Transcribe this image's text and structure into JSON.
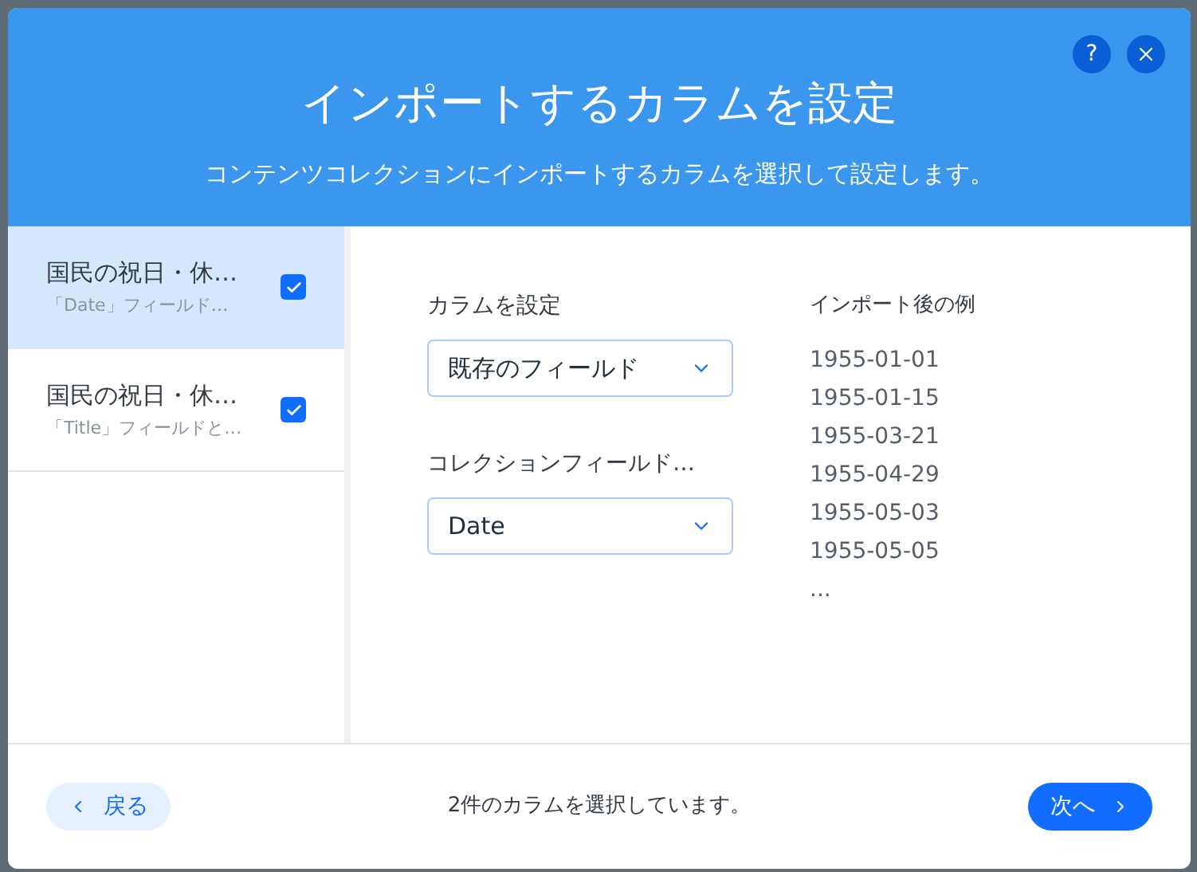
{
  "dialog": {
    "help": "?",
    "title": "インポートするカラムを設定",
    "subtitle": "コンテンツコレクションにインポートするカラムを選択して設定します。"
  },
  "columns": [
    {
      "name": "国民の祝日・休…",
      "description": "「Date」フィールド…",
      "checked": true,
      "selected": true
    },
    {
      "name": "国民の祝日・休…",
      "description": "「Title」フィールドと…",
      "checked": true,
      "selected": false
    }
  ],
  "settings": [
    {
      "label": "カラムを設定",
      "value": "既存のフィールド"
    },
    {
      "label": "コレクションフィールド…",
      "value": "Date"
    }
  ],
  "preview": {
    "heading": "インポート後の例",
    "values": [
      "1955-01-01",
      "1955-01-15",
      "1955-03-21",
      "1955-04-29",
      "1955-05-03",
      "1955-05-05",
      "..."
    ]
  },
  "footer": {
    "back": "戻る",
    "status": "2件のカラムを選択しています。",
    "next": "次へ"
  }
}
